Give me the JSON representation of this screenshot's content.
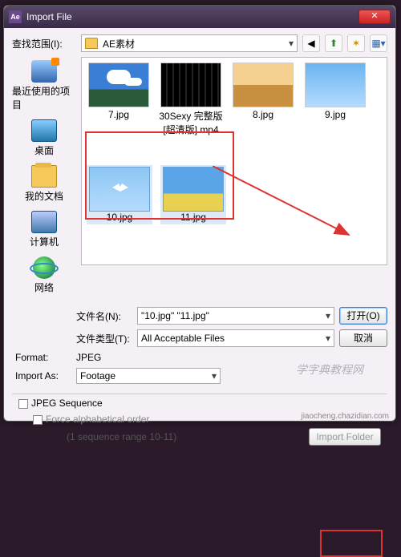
{
  "title": "Import File",
  "lookin_label": "查找范围(I):",
  "folder": "AE素材",
  "sidebar": {
    "recent": "最近使用的项目",
    "desktop": "桌面",
    "docs": "我的文档",
    "computer": "计算机",
    "network": "网络"
  },
  "files": {
    "f1": "7.jpg",
    "f2": "30Sexy 完整版[超清版].mp4",
    "f3": "8.jpg",
    "f4": "9.jpg",
    "s1": "10.jpg",
    "s2": "11.jpg"
  },
  "filename_label": "文件名(N):",
  "filename_value": "\"10.jpg\" \"11.jpg\"",
  "filetype_label": "文件类型(T):",
  "filetype_value": "All Acceptable Files",
  "open_btn": "打开(O)",
  "cancel_btn": "取消",
  "format_label": "Format:",
  "format_value": "JPEG",
  "importas_label": "Import As:",
  "importas_value": "Footage",
  "jpeg_seq": "JPEG Sequence",
  "force_alpha": "Force alphabetical order",
  "seq_range": "(1 sequence range 10-11)",
  "import_folder": "Import Folder",
  "watermark": "学字典教程网",
  "wm_url": "jiaocheng.chazidian.com",
  "app_icon": "Ae"
}
